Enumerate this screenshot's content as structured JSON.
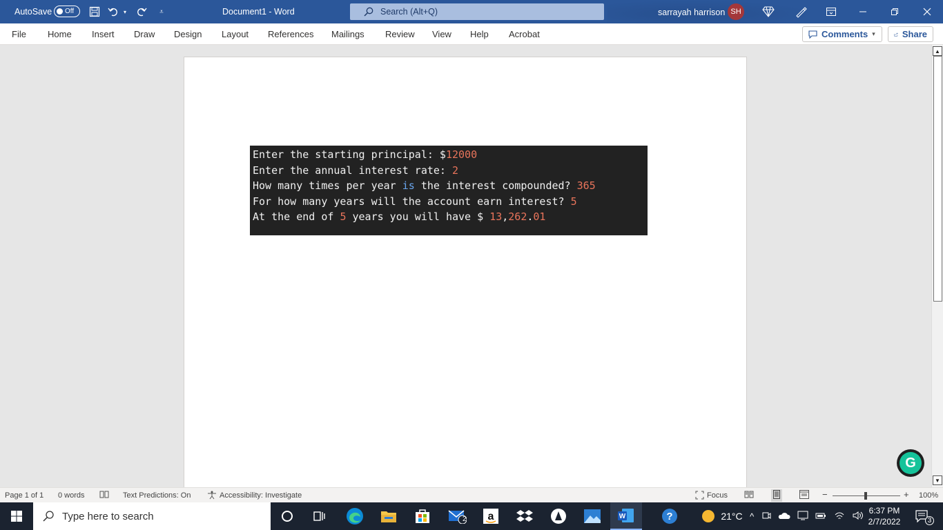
{
  "titlebar": {
    "autosave_label": "AutoSave",
    "autosave_state": "Off",
    "doc_title": "Document1  -  Word",
    "search_placeholder": "Search (Alt+Q)",
    "user_name": "sarrayah harrison",
    "user_initials": "SH",
    "accent": "#2b579a"
  },
  "ribbon": {
    "tabs": [
      "File",
      "Home",
      "Insert",
      "Draw",
      "Design",
      "Layout",
      "References",
      "Mailings",
      "Review",
      "View",
      "Help",
      "Acrobat"
    ],
    "comments_label": "Comments",
    "share_label": "Share"
  },
  "terminal": {
    "lines": [
      [
        {
          "t": "Enter the starting principal: $",
          "c": ""
        },
        {
          "t": "12000",
          "c": "num"
        }
      ],
      [
        {
          "t": "Enter the annual interest rate: ",
          "c": ""
        },
        {
          "t": "2",
          "c": "num"
        }
      ],
      [
        {
          "t": "How many times per year ",
          "c": ""
        },
        {
          "t": "is",
          "c": "kw"
        },
        {
          "t": " the interest compounded? ",
          "c": ""
        },
        {
          "t": "365",
          "c": "num"
        }
      ],
      [
        {
          "t": "For how many years will the account earn interest? ",
          "c": ""
        },
        {
          "t": "5",
          "c": "num"
        }
      ],
      [
        {
          "t": "At the end of ",
          "c": ""
        },
        {
          "t": "5",
          "c": "num"
        },
        {
          "t": " years you will have $ ",
          "c": ""
        },
        {
          "t": "13",
          "c": "num"
        },
        {
          "t": ",",
          "c": ""
        },
        {
          "t": "262",
          "c": "num"
        },
        {
          "t": ".",
          "c": ""
        },
        {
          "t": "01",
          "c": "num"
        }
      ]
    ]
  },
  "statusbar": {
    "page": "Page 1 of 1",
    "words": "0 words",
    "text_predictions": "Text Predictions: On",
    "accessibility": "Accessibility: Investigate",
    "focus": "Focus",
    "zoom_minus": "−",
    "zoom_plus": "+",
    "zoom": "100%"
  },
  "taskbar": {
    "search_placeholder": "Type here to search",
    "mail_badge": "2",
    "weather": "21°C",
    "time": "6:37 PM",
    "date": "2/7/2022",
    "notifications": "3"
  },
  "grammarly_icon": "G"
}
